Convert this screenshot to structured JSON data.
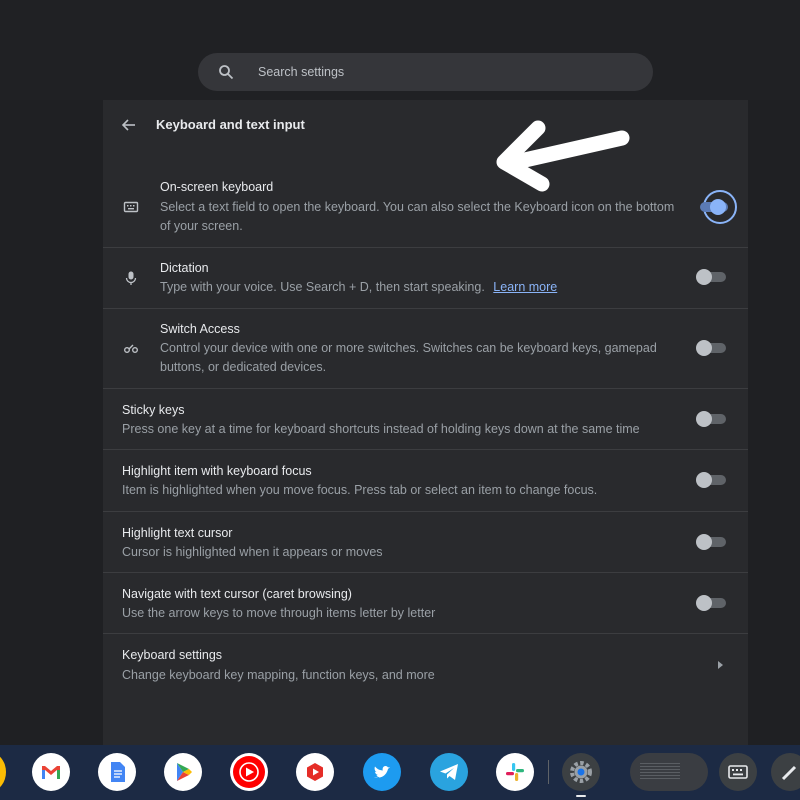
{
  "search": {
    "placeholder": "Search settings"
  },
  "page": {
    "title": "Keyboard and text input"
  },
  "settings": [
    {
      "title": "On-screen keyboard",
      "description": "Select a text field to open the keyboard. You can also select the Keyboard icon on the bottom of your screen.",
      "enabled": true,
      "icon": "keyboard-icon"
    },
    {
      "title": "Dictation",
      "description": "Type with your voice. Use Search + D, then start speaking.",
      "link": "Learn more",
      "enabled": false,
      "icon": "mic-icon"
    },
    {
      "title": "Switch Access",
      "description": "Control your device with one or more switches. Switches can be keyboard keys, gamepad buttons, or dedicated devices.",
      "enabled": false,
      "icon": "switch-access-icon"
    },
    {
      "title": "Sticky keys",
      "description": "Press one key at a time for keyboard shortcuts instead of holding keys down at the same time",
      "enabled": false
    },
    {
      "title": "Highlight item with keyboard focus",
      "description": "Item is highlighted when you move focus. Press tab or select an item to change focus.",
      "enabled": false
    },
    {
      "title": "Highlight text cursor",
      "description": "Cursor is highlighted when it appears or moves",
      "enabled": false
    },
    {
      "title": "Navigate with text cursor (caret browsing)",
      "description": "Use the arrow keys to move through items letter by letter",
      "enabled": false
    },
    {
      "title": "Keyboard settings",
      "description": "Change keyboard key mapping, function keys, and more"
    }
  ],
  "shelf": {
    "apps": [
      "gmail-icon",
      "google-docs-icon",
      "play-store-icon",
      "youtube-icon",
      "youtube-music-icon",
      "twitter-icon",
      "telegram-icon",
      "slack-icon",
      "settings-icon"
    ],
    "active_app": "settings-icon"
  },
  "colors": {
    "accent": "#8ab4f8",
    "panel": "#292a2d",
    "background": "#202124",
    "shelf": "#1c2a44"
  }
}
